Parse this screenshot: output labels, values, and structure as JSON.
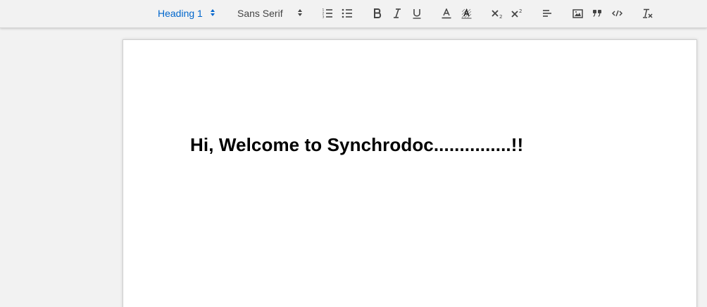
{
  "toolbar": {
    "heading_picker": {
      "value": "Heading 1"
    },
    "font_picker": {
      "value": "Sans Serif"
    },
    "buttons": [
      "ordered-list-icon",
      "bullet-list-icon",
      "bold-icon",
      "italic-icon",
      "underline-icon",
      "text-color-icon",
      "background-color-icon",
      "subscript-icon",
      "superscript-icon",
      "align-left-icon",
      "image-icon",
      "blockquote-icon",
      "code-icon",
      "clear-format-icon"
    ],
    "accent_color": "#0066cc"
  },
  "document": {
    "heading": "Hi, Welcome to Synchrodoc...............!!"
  }
}
